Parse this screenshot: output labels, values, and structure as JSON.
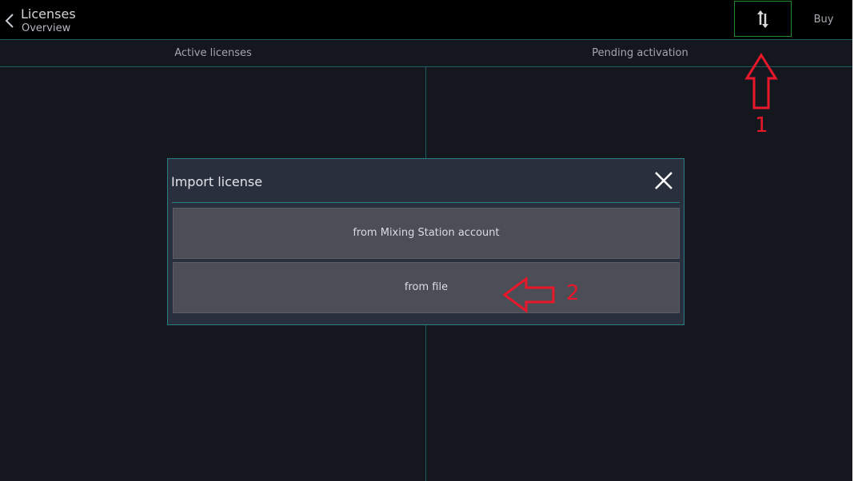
{
  "header": {
    "title": "Licenses",
    "subtitle": "Overview",
    "buy_label": "Buy"
  },
  "tabs": [
    "Active licenses",
    "Pending activation"
  ],
  "dialog": {
    "title": "Import license",
    "options": [
      "from Mixing Station account",
      "from file"
    ]
  },
  "annotations": {
    "step1": "1",
    "step2": "2",
    "color": "#e8182a"
  },
  "icons": {
    "back": "chevron-left-icon",
    "import": "import-export-icon",
    "close": "close-icon"
  }
}
